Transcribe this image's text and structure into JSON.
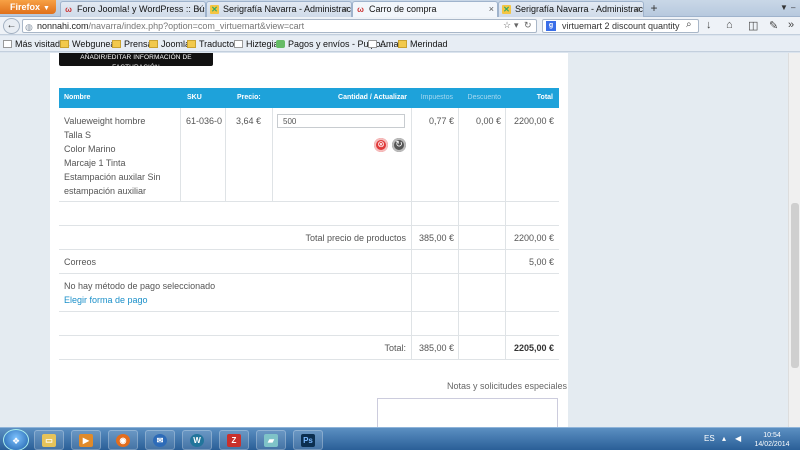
{
  "browser": {
    "app_button": "Firefox",
    "tabs": [
      {
        "title": "Foro Joomla! y WordPress :: Búsqued...",
        "icon": "joomla"
      },
      {
        "title": "Serigrafía Navarra - Administración - ...",
        "icon": "site"
      },
      {
        "title": "Carro de compra",
        "icon": "joomla",
        "active": true
      },
      {
        "title": "Serigrafía Navarra - Administración - ...",
        "icon": "site"
      }
    ],
    "url_domain": "nonnahi.com",
    "url_path": "/navarra/index.php?option=com_virtuemart&view=cart",
    "search_value": "virtuemart 2 discount quantity",
    "bookmarks": [
      "Más visitados",
      "Webguneak",
      "Prensa",
      "Joomla",
      "Traductor",
      "Hiztegia",
      "Pagos y envíos - Pulpo...",
      "Ama",
      "Merindad"
    ]
  },
  "cart": {
    "billing_button": "AÑADIR/EDITAR INFORMACIÓN DE FACTURACIÓN",
    "columns": {
      "name": "Nombre",
      "sku": "SKU",
      "price": "Precio:",
      "qty": "Cantidad / Actualizar",
      "tax": "Impuestos",
      "discount": "Descuento",
      "total": "Total"
    },
    "product": {
      "name": "Valueweight hombre",
      "attributes": [
        "Talla S",
        "Color Marino",
        "Marcaje 1 Tinta",
        "Estampación auxilar Sin",
        "estampación auxiliar"
      ],
      "sku": "61-036-0",
      "price": "3,64 €",
      "quantity": "500",
      "tax": "0,77 €",
      "discount": "0,00 €",
      "total": "2200,00 €"
    },
    "products_total": {
      "label": "Total precio de productos",
      "tax": "385,00 €",
      "total": "2200,00 €"
    },
    "shipping": {
      "label": "Correos",
      "total": "5,00 €"
    },
    "payment": {
      "text": "No hay método de pago seleccionado",
      "link": "Elegir forma de pago"
    },
    "grand_total": {
      "label": "Total:",
      "tax": "385,00 €",
      "total": "2205,00 €"
    },
    "notes_label": "Notas y solicitudes especiales"
  },
  "taskbar": {
    "language": "ES",
    "time": "10:54",
    "date": "14/02/2014"
  }
}
